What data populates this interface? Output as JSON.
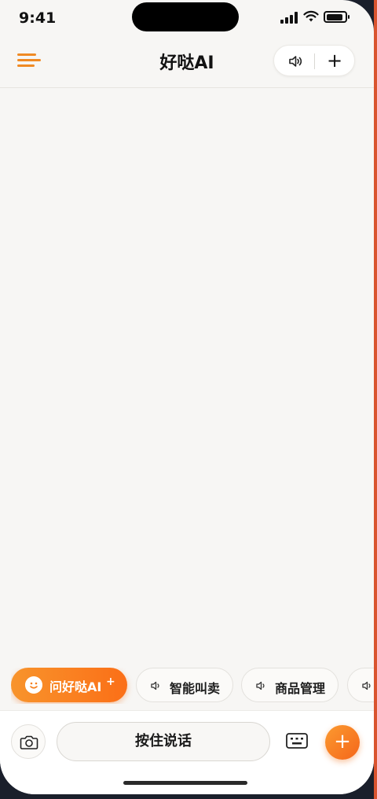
{
  "status_bar": {
    "time": "9:41",
    "icons": [
      "signal-icon",
      "wifi-icon",
      "battery-icon"
    ],
    "battery_level": 0.9
  },
  "header": {
    "title": "好哒AI",
    "menu_icon": "menu-icon",
    "sound_icon": "speaker-icon",
    "plus_label": "+"
  },
  "quick_actions": {
    "primary": {
      "label": "问好哒AI",
      "plus": "+",
      "icon": "smile-icon"
    },
    "chips": [
      {
        "label": "智能叫卖",
        "icon": "speaker-icon"
      },
      {
        "label": "商品管理",
        "icon": "speaker-icon"
      },
      {
        "label": "",
        "icon": "speaker-icon"
      }
    ]
  },
  "input_bar": {
    "talk_label": "按住说话",
    "camera_icon": "camera-icon",
    "keyboard_icon": "keyboard-icon",
    "add_label": "+"
  },
  "colors": {
    "accent": "#f8892a",
    "accent_deep": "#fb6f17",
    "background": "#f7f6f4",
    "text": "#121212"
  }
}
